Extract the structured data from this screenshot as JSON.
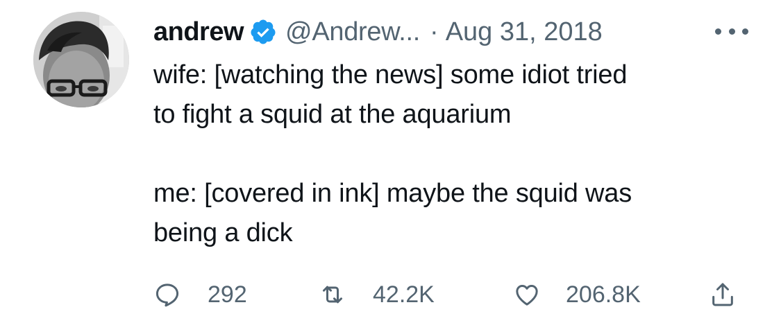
{
  "tweet": {
    "author": {
      "display_name": "andrew",
      "handle": "@Andrew...",
      "verified_icon": "verified-badge-icon"
    },
    "separator": "·",
    "date": "Aug 31, 2018",
    "more_icon": "more-icon",
    "text_lines": [
      "wife: [watching the news] some idiot tried",
      "to fight a squid at the aquarium",
      "",
      "me: [covered in ink] maybe the squid was",
      "being a dick"
    ],
    "actions": {
      "replies": "292",
      "retweets": "42.2K",
      "likes": "206.8K"
    }
  },
  "colors": {
    "text": "#0f1419",
    "secondary": "#536471",
    "verified": "#1d9bf0"
  }
}
